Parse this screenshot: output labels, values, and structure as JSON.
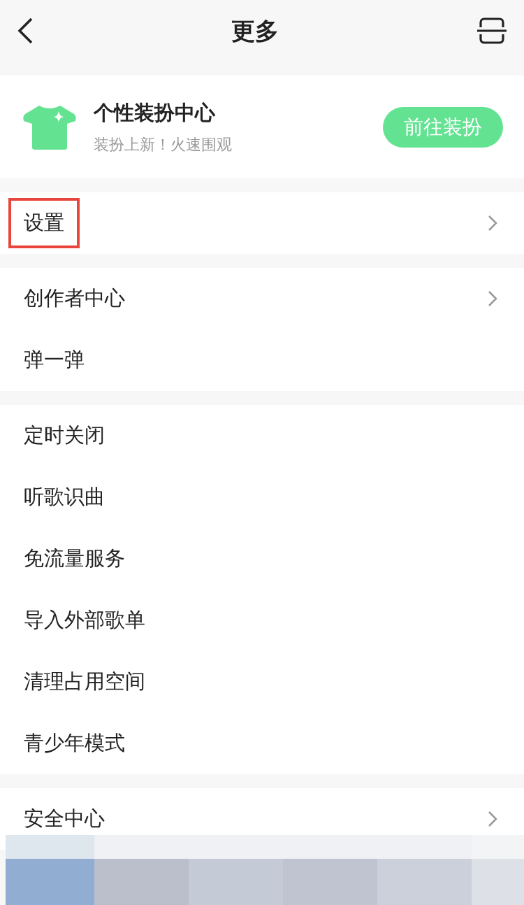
{
  "header": {
    "title": "更多"
  },
  "promo": {
    "title": "个性装扮中心",
    "subtitle": "装扮上新！火速围观",
    "button": "前往装扮"
  },
  "groups": [
    {
      "items": [
        {
          "label": "设置",
          "chevron": true,
          "highlighted": true
        }
      ]
    },
    {
      "items": [
        {
          "label": "创作者中心",
          "chevron": true,
          "highlighted": false
        },
        {
          "label": "弹一弹",
          "chevron": false,
          "highlighted": false
        }
      ]
    },
    {
      "items": [
        {
          "label": "定时关闭",
          "chevron": false,
          "highlighted": false
        },
        {
          "label": "听歌识曲",
          "chevron": false,
          "highlighted": false
        },
        {
          "label": "免流量服务",
          "chevron": false,
          "highlighted": false
        },
        {
          "label": "导入外部歌单",
          "chevron": false,
          "highlighted": false
        },
        {
          "label": "清理占用空间",
          "chevron": false,
          "highlighted": false
        },
        {
          "label": "青少年模式",
          "chevron": false,
          "highlighted": false
        }
      ]
    },
    {
      "items": [
        {
          "label": "安全中心",
          "chevron": true,
          "highlighted": false
        }
      ]
    }
  ]
}
